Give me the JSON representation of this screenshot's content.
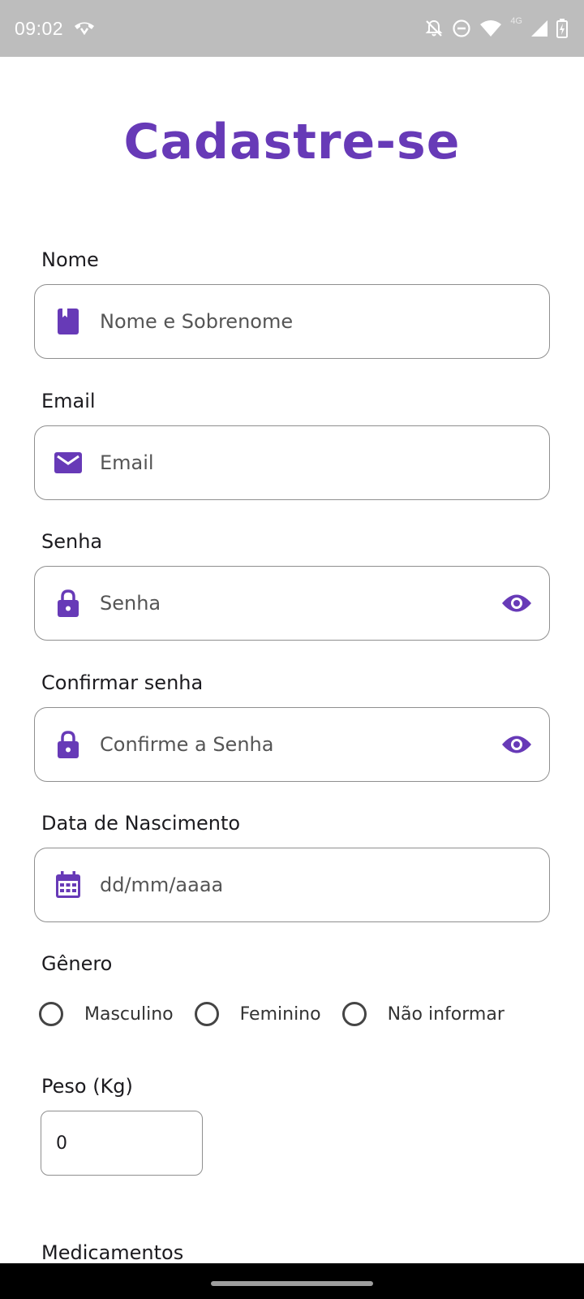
{
  "status_bar": {
    "time": "09:02",
    "network": "4G",
    "icons": [
      "call-end-icon",
      "alarm-off-icon",
      "do-not-disturb-icon",
      "wifi-icon",
      "signal-icon",
      "battery-icon"
    ]
  },
  "page": {
    "title": "Cadastre-se",
    "accent_color": "#673ab7"
  },
  "form": {
    "name": {
      "label": "Nome",
      "placeholder": "Nome e Sobrenome",
      "value": "",
      "icon": "badge-icon"
    },
    "email": {
      "label": "Email",
      "placeholder": "Email",
      "value": "",
      "icon": "mail-icon"
    },
    "password": {
      "label": "Senha",
      "placeholder": "Senha",
      "value": "",
      "icon": "lock-icon",
      "trailing_icon": "eye-icon"
    },
    "confirm_password": {
      "label": "Confirmar senha",
      "placeholder": "Confirme a Senha",
      "value": "",
      "icon": "lock-icon",
      "trailing_icon": "eye-icon"
    },
    "birth_date": {
      "label": "Data de Nascimento",
      "placeholder": "dd/mm/aaaa",
      "value": "",
      "icon": "calendar-icon"
    },
    "gender": {
      "label": "Gênero",
      "options": [
        "Masculino",
        "Feminino",
        "Não informar"
      ],
      "selected": null
    },
    "weight": {
      "label": "Peso (Kg)",
      "value": "0"
    },
    "medications": {
      "label": "Medicamentos"
    }
  }
}
